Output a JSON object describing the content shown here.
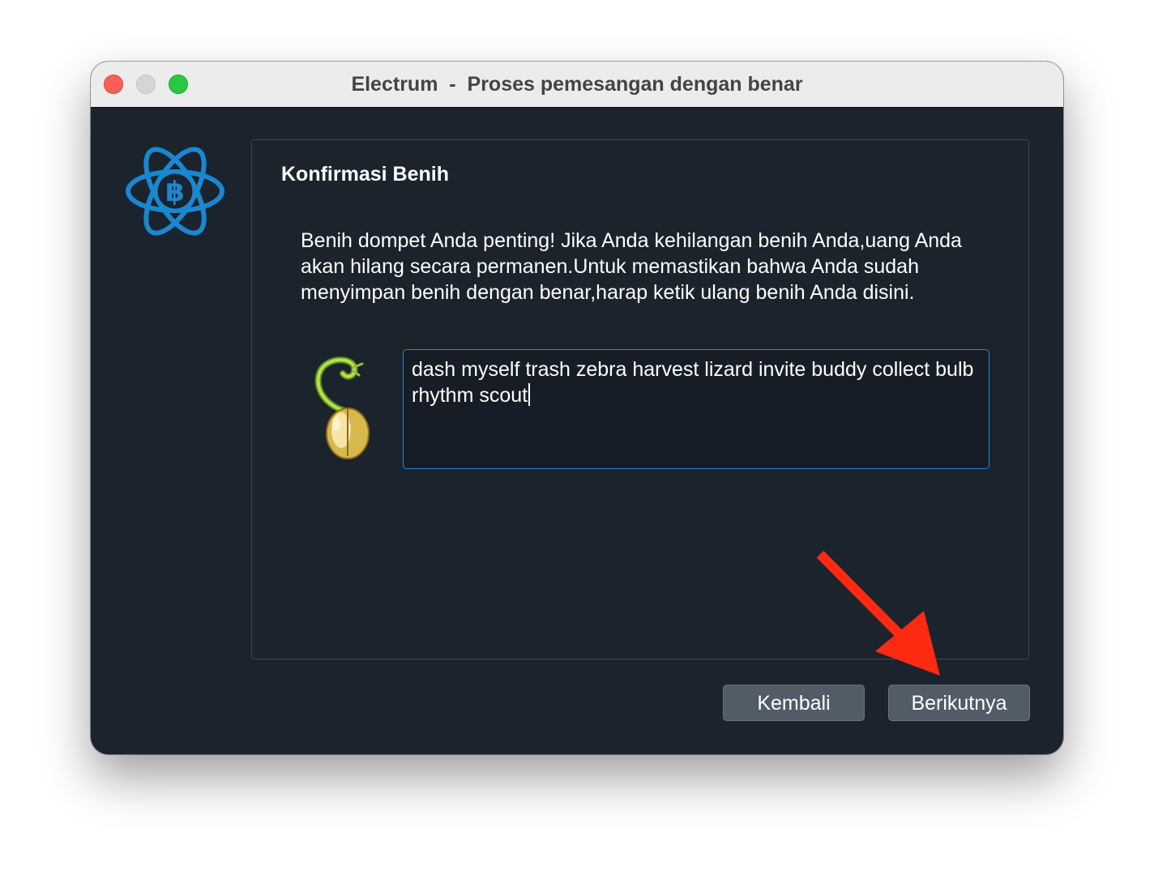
{
  "window": {
    "title": "Electrum  -  Proses pemesangan dengan benar",
    "traffic_lights": [
      "close",
      "minimize",
      "zoom"
    ]
  },
  "panel": {
    "title": "Konfirmasi Benih",
    "description": "Benih dompet Anda penting! Jika Anda kehilangan benih Anda,uang Anda akan hilang secara permanen.Untuk memastikan bahwa Anda sudah menyimpan benih dengan benar,harap ketik ulang benih Anda disini.",
    "seed_input_value": "dash myself trash zebra harvest lizard invite buddy collect bulb rhythm scout"
  },
  "buttons": {
    "back_label": "Kembali",
    "next_label": "Berikutnya"
  },
  "icons": {
    "logo": "electrum-bitcoin-logo-icon",
    "seed": "sprouting-seed-icon",
    "annotation": "red-arrow-icon"
  },
  "colors": {
    "window_bg": "#1b232d",
    "titlebar_bg": "#ececec",
    "accent": "#2f86c9",
    "button_bg": "#525c66",
    "arrow": "#ff2a12"
  }
}
